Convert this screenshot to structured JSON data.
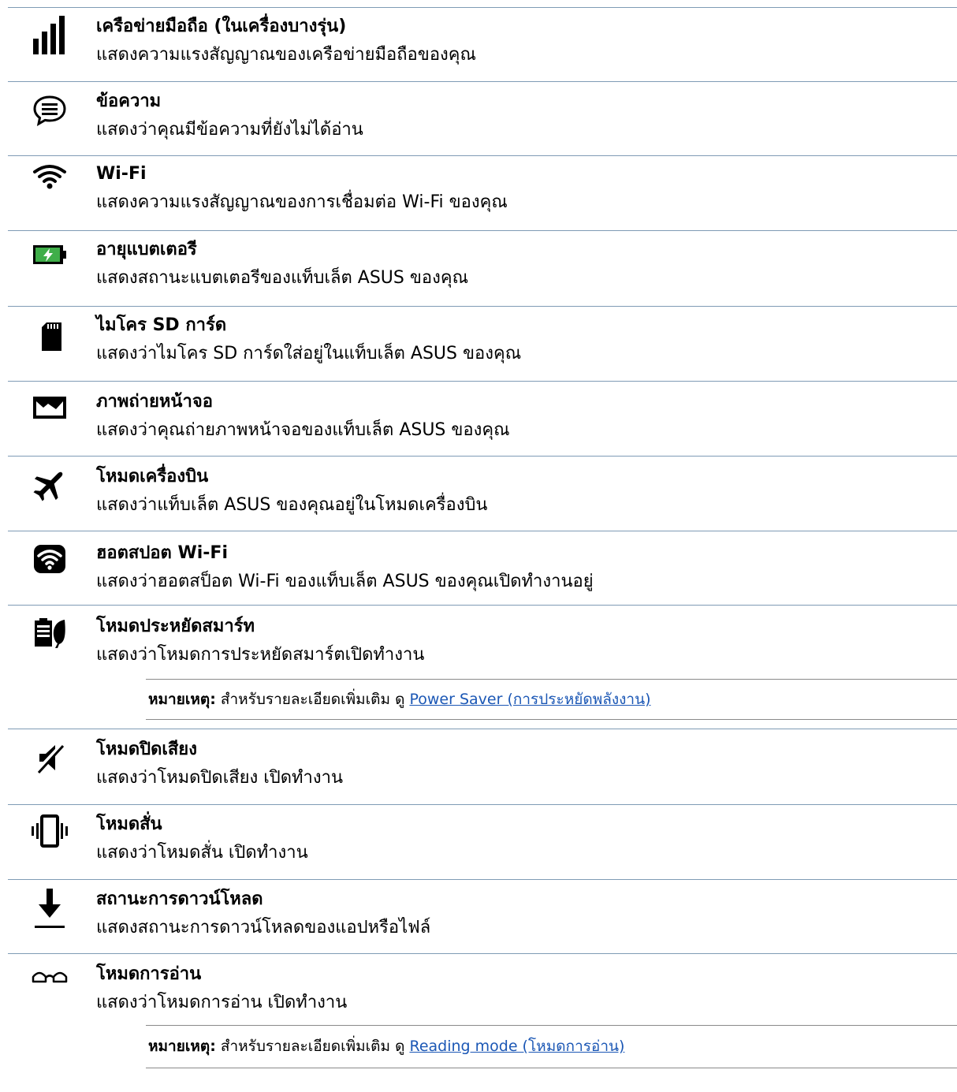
{
  "items": [
    {
      "icon": "signal-bars-icon",
      "title": "เครือข่ายมือถือ (ในเครื่องบางรุ่น)",
      "desc": "แสดงความแรงสัญญาณของเครือข่ายมือถือของคุณ"
    },
    {
      "icon": "message-icon",
      "title": "ข้อความ",
      "desc": "แสดงว่าคุณมีข้อความที่ยังไม่ได้อ่าน"
    },
    {
      "icon": "wifi-icon",
      "title": "Wi-Fi",
      "desc": "แสดงความแรงสัญญาณของการเชื่อมต่อ Wi-Fi ของคุณ"
    },
    {
      "icon": "battery-icon",
      "title": "อายุแบตเตอรี",
      "desc": "แสดงสถานะแบตเตอรีของแท็บเล็ต ASUS ของคุณ"
    },
    {
      "icon": "sd-card-icon",
      "title": "ไมโคร SD การ์ด",
      "desc": "แสดงว่าไมโคร SD การ์ดใส่อยู่ในแท็บเล็ต ASUS ของคุณ"
    },
    {
      "icon": "screenshot-icon",
      "title": "ภาพถ่ายหน้าจอ",
      "desc": "แสดงว่าคุณถ่ายภาพหน้าจอของแท็บเล็ต ASUS ของคุณ"
    },
    {
      "icon": "airplane-icon",
      "title": "โหมดเครื่องบิน",
      "desc": "แสดงว่าแท็บเล็ต ASUS ของคุณอยู่ในโหมดเครื่องบิน"
    },
    {
      "icon": "hotspot-icon",
      "title": "ฮอตสปอต Wi-Fi",
      "desc": "แสดงว่าฮอตสป็อต Wi-Fi ของแท็บเล็ต ASUS ของคุณเปิดทำงานอยู่"
    },
    {
      "icon": "smart-saving-icon",
      "title": "โหมดประหยัดสมาร์ท",
      "desc": "แสดงว่าโหมดการประหยัดสมาร์ตเปิดทำงาน"
    },
    {
      "icon": "mute-icon",
      "title": "โหมดปิดเสียง",
      "desc": "แสดงว่าโหมดปิดเสียง เปิดทำงาน"
    },
    {
      "icon": "vibrate-icon",
      "title": "โหมดสั่น",
      "desc": "แสดงว่าโหมดสั่น เปิดทำงาน"
    },
    {
      "icon": "download-icon",
      "title": "สถานะการดาวน์โหลด",
      "desc": "แสดงสถานะการดาวน์โหลดของแอปหรือไฟล์"
    },
    {
      "icon": "reading-glasses-icon",
      "title": "โหมดการอ่าน",
      "desc": "แสดงว่าโหมดการอ่าน เปิดทำงาน"
    }
  ],
  "notes": [
    {
      "label": "หมายเหตุ:",
      "text": " สำหรับรายละเอียดเพิ่มเติม ดู ",
      "link": "Power Saver (การประหยัดพลังงาน)"
    },
    {
      "label": "หมายเหตุ:",
      "text": " สำหรับรายละเอียดเพิ่มเติม ดู ",
      "link": "Reading mode (โหมดการอ่าน)"
    }
  ],
  "colors": {
    "rule": "#7f9bb5",
    "link": "#1b57b5",
    "battery": "#3fae49"
  }
}
